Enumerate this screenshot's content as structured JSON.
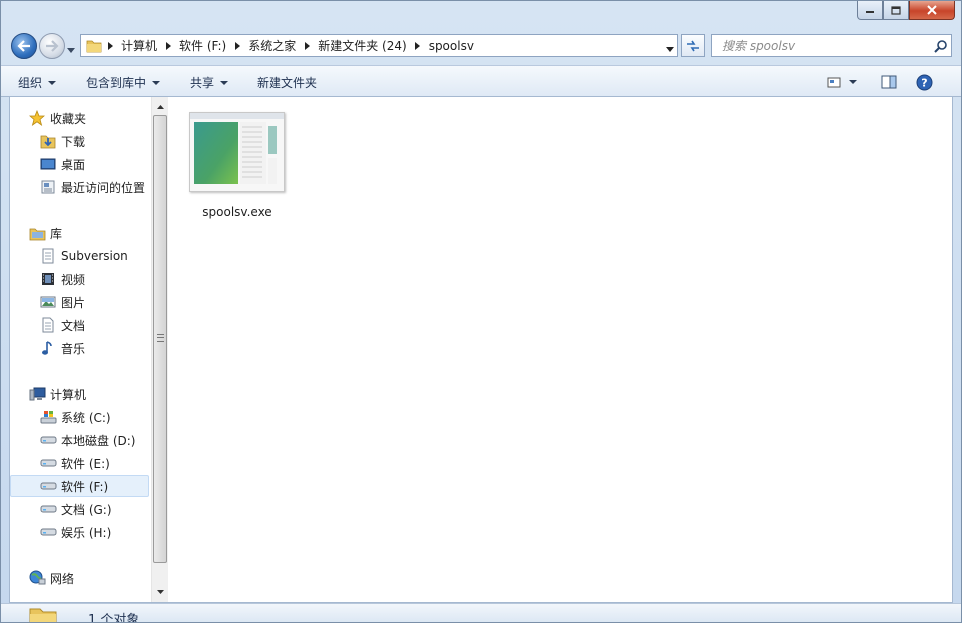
{
  "window": {
    "caption": {
      "minimize_icon": "minimize-icon",
      "maximize_icon": "maximize-icon",
      "close_icon": "close-icon"
    }
  },
  "navbar": {
    "breadcrumbs": [
      "计算机",
      "软件 (F:)",
      "系统之家",
      "新建文件夹 (24)",
      "spoolsv"
    ],
    "search_placeholder": "搜索 spoolsv"
  },
  "toolbar": {
    "organize": "组织",
    "include_in_library": "包含到库中",
    "share": "共享",
    "new_folder": "新建文件夹"
  },
  "sidebar": {
    "favorites": {
      "label": "收藏夹",
      "items": [
        "下载",
        "桌面",
        "最近访问的位置"
      ]
    },
    "libraries": {
      "label": "库",
      "items": [
        "Subversion",
        "视频",
        "图片",
        "文档",
        "音乐"
      ]
    },
    "computer": {
      "label": "计算机",
      "items": [
        "系统 (C:)",
        "本地磁盘 (D:)",
        "软件 (E:)",
        "软件 (F:)",
        "文档 (G:)",
        "娱乐 (H:)"
      ]
    },
    "network": {
      "label": "网络"
    },
    "selected": "软件 (F:)"
  },
  "files": [
    {
      "name": "spoolsv.exe",
      "icon": "exe-file-icon"
    }
  ],
  "status": {
    "text": "1 个对象"
  }
}
